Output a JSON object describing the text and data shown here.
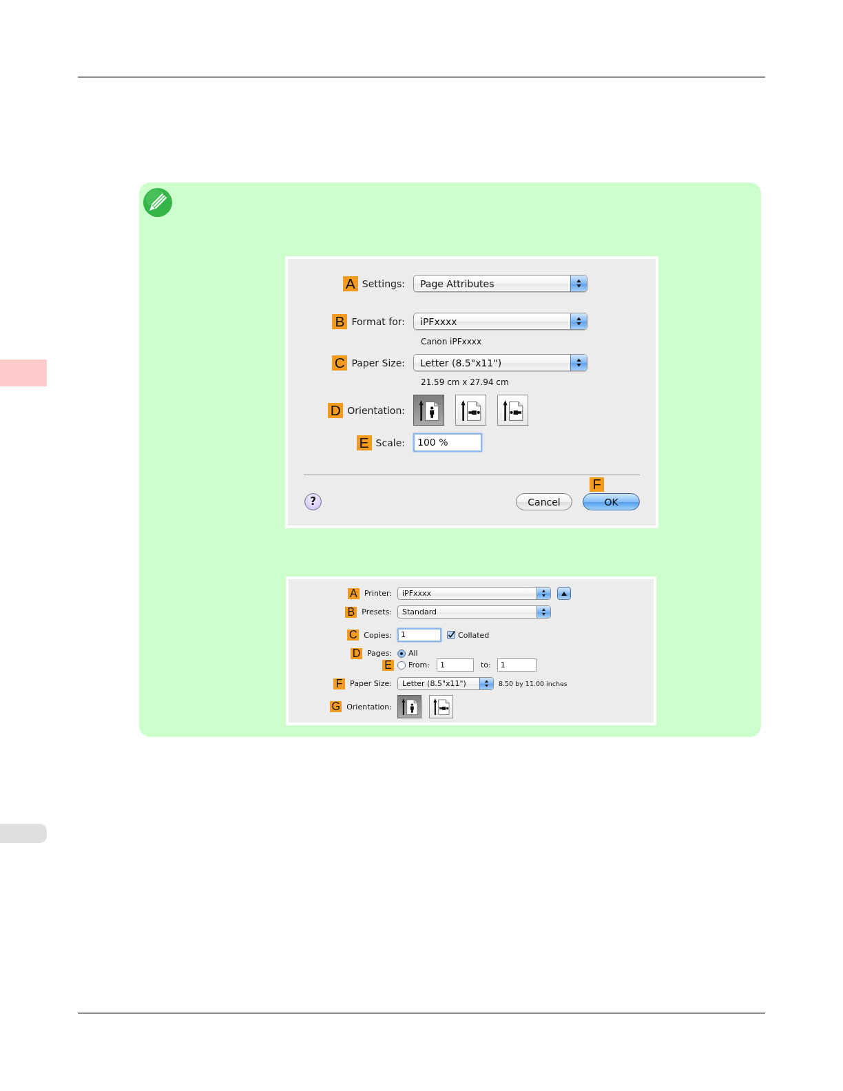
{
  "page_setup_dialog": {
    "rows": [
      {
        "kind": "popup",
        "marker": "A",
        "label": "Settings:",
        "value": "Page Attributes"
      },
      {
        "kind": "popup",
        "marker": "B",
        "label": "Format for:",
        "value": "iPFxxxx",
        "note": "Canon iPFxxxx"
      },
      {
        "kind": "popup",
        "marker": "C",
        "label": "Paper Size:",
        "value": "Letter (8.5\"x11\")",
        "note": "21.59 cm x 27.94 cm"
      },
      {
        "kind": "orientation",
        "marker": "D",
        "label": "Orientation:",
        "options": [
          {
            "kind": "portrait",
            "selected": true
          },
          {
            "kind": "landscape_left",
            "selected": false
          },
          {
            "kind": "landscape_right",
            "selected": false
          }
        ]
      },
      {
        "kind": "text_field",
        "marker": "E",
        "label": "Scale:",
        "value": "100 %",
        "focused": true
      }
    ],
    "help_button": {
      "label": "?"
    },
    "buttons": [
      {
        "label": "Cancel",
        "default": false
      },
      {
        "label": "OK",
        "default": true,
        "marker": "F"
      }
    ]
  },
  "print_dialog": {
    "rows": [
      {
        "kind": "popup",
        "marker": "A",
        "label": "Printer:",
        "value": "iPFxxxx",
        "disclosure": true
      },
      {
        "kind": "popup",
        "marker": "B",
        "label": "Presets:",
        "value": "Standard"
      },
      {
        "kind": "copies",
        "marker": "C",
        "label": "Copies:",
        "value": "1",
        "focused": true,
        "checkbox": {
          "label": "Collated",
          "checked": true
        }
      },
      {
        "kind": "radio",
        "marker": "D",
        "label": "Pages:",
        "option": {
          "label": "All",
          "selected": true
        }
      },
      {
        "kind": "range",
        "marker": "E",
        "option": {
          "label": "From:",
          "selected": false
        },
        "from": "1",
        "to_label": "to:",
        "to": "1"
      },
      {
        "kind": "popup",
        "marker": "F",
        "label": "Paper Size:",
        "value": "Letter (8.5\"x11\")",
        "note": "8.50 by 11.00 inches"
      },
      {
        "kind": "orientation",
        "marker": "G",
        "label": "Orientation:",
        "options": [
          {
            "kind": "portrait",
            "selected": true
          },
          {
            "kind": "landscape_left",
            "selected": false
          }
        ]
      }
    ]
  }
}
